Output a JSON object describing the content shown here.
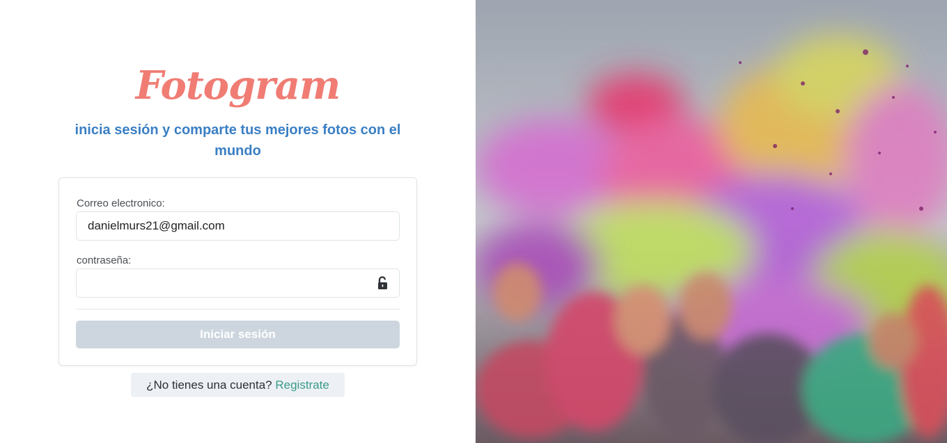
{
  "brand": {
    "logo_text": "Fotogram",
    "logo_color": "#f07c74"
  },
  "tagline": "inicia sesión y comparte tus mejores fotos con el mundo",
  "form": {
    "email_label": "Correo electronico:",
    "email_value": "danielmurs21@gmail.com",
    "password_label": "contraseña:",
    "password_value": "",
    "lock_icon": "unlocked-padlock-icon",
    "submit_label": "Iniciar sesión"
  },
  "signup": {
    "prompt": "¿No tienes una cuenta?",
    "link_label": "Registrate"
  },
  "hero_image": {
    "alt": "people-celebrating-holi-color-festival"
  },
  "colors": {
    "accent_blue": "#3a7fc4",
    "link_teal": "#3a9a8a",
    "button_disabled": "#cdd6df"
  }
}
